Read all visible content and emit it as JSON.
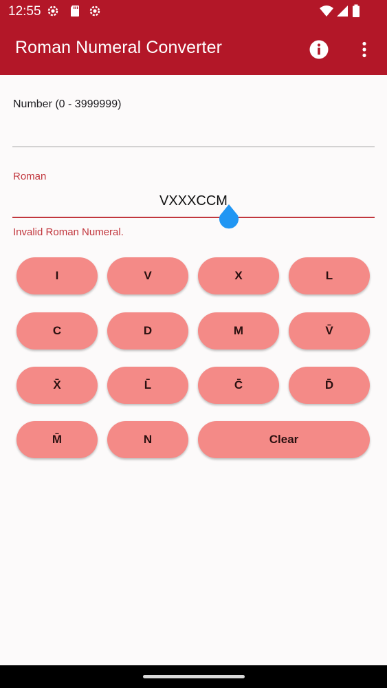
{
  "status_bar": {
    "time": "12:55",
    "left_icons": [
      "gear-icon",
      "sd-card-icon",
      "gear-icon"
    ],
    "right_icons": [
      "wifi-icon",
      "signal-icon",
      "battery-icon"
    ]
  },
  "app_bar": {
    "title": "Roman Numeral Converter",
    "background": "#b31728",
    "actions": [
      "info-icon",
      "more-vert-icon"
    ]
  },
  "number_field": {
    "label": "Number (0 - 3999999)",
    "value": ""
  },
  "roman_field": {
    "label": "Roman",
    "value": "VXXXCCM",
    "error": "Invalid Roman Numeral.",
    "error_color": "#c1363d"
  },
  "keypad": {
    "color": "#f48a87",
    "keys": [
      {
        "label": "I"
      },
      {
        "label": "V"
      },
      {
        "label": "X"
      },
      {
        "label": "L"
      },
      {
        "label": "C"
      },
      {
        "label": "D"
      },
      {
        "label": "M"
      },
      {
        "label": "V̄"
      },
      {
        "label": "X̄"
      },
      {
        "label": "L̄"
      },
      {
        "label": "C̄"
      },
      {
        "label": "D̄"
      },
      {
        "label": "M̄"
      },
      {
        "label": "N"
      },
      {
        "label": "Clear"
      }
    ]
  }
}
